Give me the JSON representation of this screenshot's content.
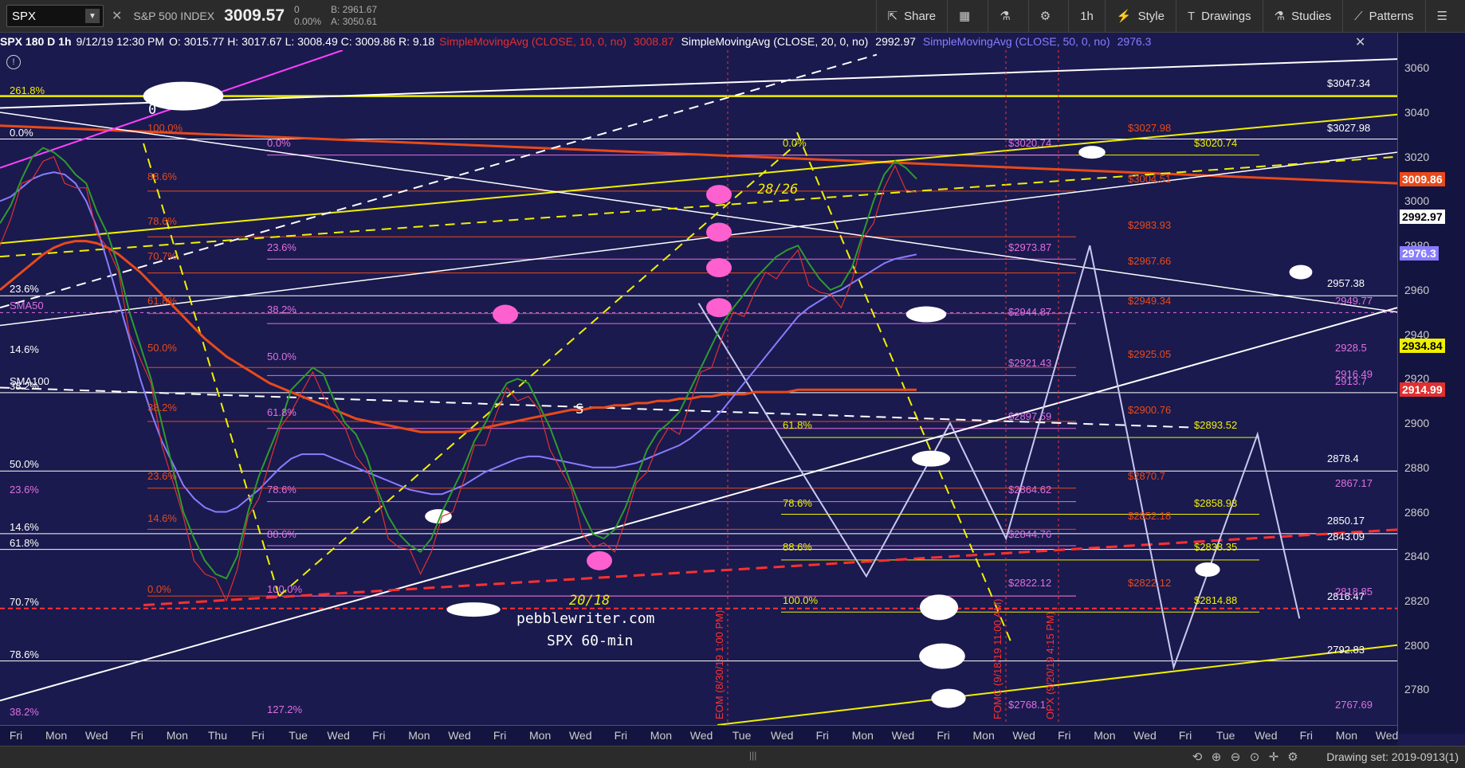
{
  "toolbar": {
    "symbol": "SPX",
    "index_name": "S&P 500 INDEX",
    "last": "3009.57",
    "change": "0",
    "change_pct": "0.00%",
    "bid": "B: 2961.67",
    "ask": "A: 3050.61",
    "buttons": [
      "Share",
      "1h",
      "Style",
      "Drawings",
      "Studies",
      "Patterns"
    ]
  },
  "legend": {
    "symbol_info": "SPX 180 D 1h",
    "timestamp": "9/12/19 12:30 PM",
    "ohlc": "O: 3015.77 H: 3017.67 L: 3008.49 C: 3009.86 R: 9.18",
    "sma10_label": "SimpleMovingAvg (CLOSE, 10, 0, no)",
    "sma10_value": "3008.87",
    "sma20_label": "SimpleMovingAvg (CLOSE, 20, 0, no)",
    "sma20_value": "2992.97",
    "sma50_label": "SimpleMovingAvg (CLOSE, 50, 0, no)",
    "sma50_value": "2976.3",
    "colors": {
      "sma10": "#e03030",
      "sma20": "#ffffff",
      "sma50": "#8a7cff"
    }
  },
  "chart_data": {
    "type": "line",
    "title": "SPX 60-min",
    "watermark": "pebblewriter.com",
    "ylim": [
      2764,
      3068
    ],
    "y_ticks": [
      2780,
      2800,
      2820,
      2840,
      2860,
      2880,
      2900,
      2920,
      2940,
      2960,
      2980,
      3000,
      3020,
      3040,
      3060
    ],
    "x_ticks": [
      "Fri",
      "Mon",
      "Wed",
      "Fri",
      "Mon",
      "Thu",
      "Fri",
      "Tue",
      "Wed",
      "Fri",
      "Mon",
      "Wed",
      "Fri",
      "Mon",
      "Wed",
      "Fri",
      "Mon",
      "Wed",
      "Tue",
      "Wed",
      "Fri",
      "Mon",
      "Wed",
      "Fri",
      "Mon",
      "Wed",
      "Fri",
      "Mon",
      "Wed",
      "Fri",
      "Tue",
      "Wed",
      "Fri",
      "Mon",
      "Wed"
    ],
    "axis_badges": [
      {
        "value": 3009.86,
        "label": "3009.86",
        "bg": "#e84a1a",
        "fg": "#fff"
      },
      {
        "value": 2992.97,
        "label": "2992.97",
        "bg": "#ffffff",
        "fg": "#000"
      },
      {
        "value": 2976.3,
        "label": "2976.3",
        "bg": "#8a7cff",
        "fg": "#fff"
      },
      {
        "value": 2934.84,
        "label": "2934.84",
        "bg": "#f0f000",
        "fg": "#000"
      },
      {
        "value": 2914.99,
        "label": "2914.99",
        "bg": "#e03030",
        "fg": "#fff"
      }
    ],
    "price_series": [
      2990,
      2998,
      3010,
      3020,
      3024,
      3022,
      3018,
      3012,
      3008,
      2995,
      2985,
      2970,
      2950,
      2935,
      2920,
      2900,
      2880,
      2860,
      2848,
      2838,
      2832,
      2830,
      2840,
      2860,
      2876,
      2888,
      2900,
      2915,
      2920,
      2925,
      2922,
      2910,
      2900,
      2895,
      2885,
      2870,
      2858,
      2850,
      2845,
      2842,
      2848,
      2860,
      2870,
      2880,
      2892,
      2900,
      2910,
      2918,
      2920,
      2918,
      2908,
      2898,
      2885,
      2872,
      2860,
      2850,
      2848,
      2852,
      2862,
      2875,
      2888,
      2896,
      2900,
      2905,
      2915,
      2925,
      2935,
      2945,
      2952,
      2958,
      2965,
      2970,
      2975,
      2978,
      2980,
      2972,
      2965,
      2960,
      2962,
      2970,
      2985,
      3000,
      3012,
      3018,
      3015,
      3010
    ],
    "sma50_series": [
      3000,
      3002,
      3006,
      3010,
      3012,
      3013,
      3012,
      3008,
      3000,
      2988,
      2972,
      2955,
      2938,
      2920,
      2905,
      2892,
      2882,
      2872,
      2866,
      2862,
      2860,
      2860,
      2862,
      2866,
      2870,
      2875,
      2880,
      2884,
      2886,
      2886,
      2886,
      2884,
      2882,
      2880,
      2878,
      2876,
      2874,
      2872,
      2870,
      2869,
      2868,
      2868,
      2870,
      2872,
      2875,
      2878,
      2880,
      2882,
      2884,
      2885,
      2885,
      2884,
      2883,
      2882,
      2881,
      2880,
      2880,
      2880,
      2881,
      2882,
      2884,
      2886,
      2888,
      2890,
      2893,
      2897,
      2901,
      2906,
      2912,
      2918,
      2924,
      2930,
      2936,
      2942,
      2948,
      2952,
      2955,
      2958,
      2960,
      2963,
      2966,
      2969,
      2972,
      2974,
      2975,
      2976
    ],
    "sma100_series": [
      2960,
      2964,
      2968,
      2972,
      2976,
      2979,
      2981,
      2982,
      2982,
      2981,
      2979,
      2976,
      2972,
      2968,
      2963,
      2958,
      2953,
      2948,
      2943,
      2938,
      2934,
      2930,
      2927,
      2924,
      2921,
      2918,
      2916,
      2914,
      2912,
      2910,
      2908,
      2906,
      2904,
      2902,
      2901,
      2900,
      2899,
      2898,
      2897,
      2896,
      2896,
      2896,
      2896,
      2896,
      2897,
      2898,
      2899,
      2900,
      2901,
      2902,
      2903,
      2904,
      2905,
      2906,
      2906,
      2907,
      2907,
      2908,
      2908,
      2909,
      2909,
      2910,
      2910,
      2911,
      2911,
      2912,
      2912,
      2913,
      2913,
      2913,
      2914,
      2914,
      2914,
      2914,
      2915,
      2915,
      2915,
      2915,
      2915,
      2915,
      2915,
      2915,
      2915,
      2915,
      2915,
      2915
    ],
    "projection": [
      {
        "x": 0.5,
        "y": 2954
      },
      {
        "x": 0.56,
        "y": 2892
      },
      {
        "x": 0.62,
        "y": 2831
      },
      {
        "x": 0.68,
        "y": 2900
      },
      {
        "x": 0.72,
        "y": 2848
      },
      {
        "x": 0.78,
        "y": 2980
      },
      {
        "x": 0.84,
        "y": 2790
      },
      {
        "x": 0.9,
        "y": 2895
      },
      {
        "x": 0.93,
        "y": 2812
      }
    ],
    "labels": {
      "fib_left": [
        "261.8%",
        "0.0%",
        "23.6%",
        "SMA50",
        "14.6%",
        "SMA100",
        "38.2%",
        "50.0%",
        "23.6%",
        "14.6%",
        "61.8%",
        "70.7%",
        "78.6%",
        "38.2%"
      ],
      "fib_mid_red": [
        "100.0%",
        "88.6%",
        "78.6%",
        "70.7%",
        "61.8%",
        "50.0%",
        "38.2%",
        "23.6%",
        "14.6%",
        "0.0%"
      ],
      "fib_mid_magenta": [
        "0.0%",
        "23.6%",
        "38.2%",
        "50.0%",
        "61.8%",
        "78.6%",
        "88.6%",
        "100.0%",
        "127.2%"
      ],
      "fib_right_yellow": [
        "0.0%",
        "61.8%",
        "78.6%",
        "88.6%",
        "100.0%"
      ],
      "target_magenta": [
        "$3020.74",
        "$2973.87",
        "$2944.87",
        "$2921.43",
        "$2897.59",
        "$2864.62",
        "$2844.76",
        "$2822.12",
        "$2768.1"
      ],
      "target_red": [
        "$3027.98",
        "$3004.51",
        "$2983.93",
        "$2967.66",
        "$2949.34",
        "$2925.05",
        "$2900.76",
        "$2870.7",
        "$2852.18",
        "$2822.12"
      ],
      "target_yellow": [
        "$3020.74",
        "$2893.52",
        "$2858.93",
        "$2838.35",
        "$2814.88"
      ],
      "target_white": [
        "$3047.34",
        "$3027.98",
        "2957.38",
        "2878.4",
        "2850.17",
        "2843.09",
        "2816.47",
        "2792.83"
      ],
      "target_pink_right": [
        "2949.77",
        "2928.5",
        "2916.49",
        "2913.7",
        "2867.17",
        "2767.69",
        "2818.85"
      ],
      "annotations": [
        "28/26",
        "20/18",
        "S",
        "0"
      ],
      "vlines": [
        "EOM (8/30/19 1:00 PM)",
        "FOMC (9/18/19 11:00 AM)",
        "OPX (9/20/19 4:15 PM)"
      ]
    }
  },
  "bottom": {
    "drawing_set": "Drawing set: 2019-0913(1)"
  }
}
